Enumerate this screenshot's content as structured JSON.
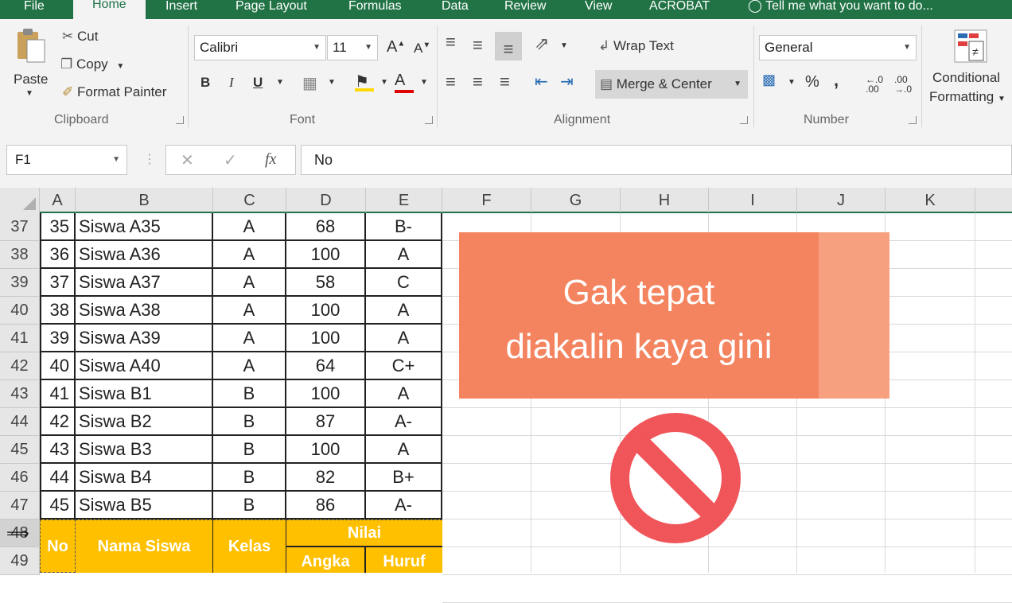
{
  "ribbon_tabs": [
    "File",
    "Home",
    "Insert",
    "Page Layout",
    "Formulas",
    "Data",
    "Review",
    "View",
    "ACROBAT"
  ],
  "tell_me": "Tell me what you want to do...",
  "clipboard": {
    "paste": "Paste",
    "cut": "Cut",
    "copy": "Copy",
    "format_painter": "Format Painter",
    "group": "Clipboard"
  },
  "font": {
    "name": "Calibri",
    "size": "11",
    "group": "Font",
    "bold": "B",
    "italic": "I",
    "underline": "U",
    "grow": "A",
    "shrink": "A",
    "color_glyph": "A"
  },
  "alignment": {
    "wrap_text": "Wrap Text",
    "merge_center": "Merge & Center",
    "group": "Alignment"
  },
  "number": {
    "format": "General",
    "group": "Number",
    "percent": "%",
    "comma": ",",
    "inc_decimal": "←.0 .00",
    "dec_decimal": ".00 →.0"
  },
  "styles": {
    "conditional": "Conditional",
    "formatting": "Formatting"
  },
  "formula_bar": {
    "name_box": "F1",
    "fx": "fx",
    "value": "No"
  },
  "columns": [
    "A",
    "B",
    "C",
    "D",
    "E",
    "F",
    "G",
    "H",
    "I",
    "J",
    "K"
  ],
  "rows": [
    {
      "num": "37",
      "no": "35",
      "nama": "Siswa A35",
      "kelas": "A",
      "angka": "68",
      "huruf": "B-"
    },
    {
      "num": "38",
      "no": "36",
      "nama": "Siswa A36",
      "kelas": "A",
      "angka": "100",
      "huruf": "A"
    },
    {
      "num": "39",
      "no": "37",
      "nama": "Siswa A37",
      "kelas": "A",
      "angka": "58",
      "huruf": "C"
    },
    {
      "num": "40",
      "no": "38",
      "nama": "Siswa A38",
      "kelas": "A",
      "angka": "100",
      "huruf": "A"
    },
    {
      "num": "41",
      "no": "39",
      "nama": "Siswa A39",
      "kelas": "A",
      "angka": "100",
      "huruf": "A"
    },
    {
      "num": "42",
      "no": "40",
      "nama": "Siswa A40",
      "kelas": "A",
      "angka": "64",
      "huruf": "C+"
    },
    {
      "num": "43",
      "no": "41",
      "nama": "Siswa B1",
      "kelas": "B",
      "angka": "100",
      "huruf": "A"
    },
    {
      "num": "44",
      "no": "42",
      "nama": "Siswa B2",
      "kelas": "B",
      "angka": "87",
      "huruf": "A-"
    },
    {
      "num": "45",
      "no": "43",
      "nama": "Siswa B3",
      "kelas": "B",
      "angka": "100",
      "huruf": "A"
    },
    {
      "num": "46",
      "no": "44",
      "nama": "Siswa B4",
      "kelas": "B",
      "angka": "82",
      "huruf": "B+"
    },
    {
      "num": "47",
      "no": "45",
      "nama": "Siswa B5",
      "kelas": "B",
      "angka": "86",
      "huruf": "A-"
    }
  ],
  "header_rows": [
    "48",
    "49"
  ],
  "table_header": {
    "no": "No",
    "nama": "Nama Siswa",
    "kelas": "Kelas",
    "nilai": "Nilai",
    "angka": "Angka",
    "huruf": "Huruf"
  },
  "overlay": {
    "line1": "Gak tepat",
    "line2": "diakalin kaya gini"
  },
  "colors": {
    "excel_green": "#217346",
    "header_yellow": "#ffc000",
    "banner": "#f4845f",
    "no_sign": "#f0555a"
  }
}
